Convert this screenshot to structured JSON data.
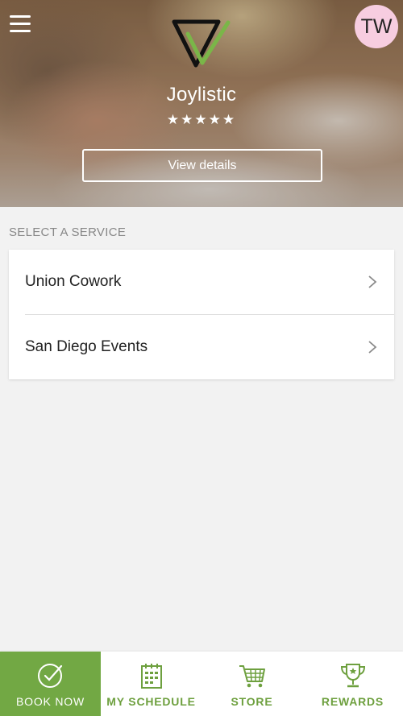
{
  "header": {
    "brand": "Joylistic",
    "rating_stars": "★★★★★",
    "rating": 5,
    "view_details": "View details",
    "avatar_initials": "TW",
    "avatar_color": "#f7cde0"
  },
  "section_title": "SELECT A SERVICE",
  "services": [
    {
      "label": "Union Cowork"
    },
    {
      "label": "San Diego Events"
    }
  ],
  "tabs": [
    {
      "label": "BOOK NOW",
      "icon": "check-circle-icon",
      "active": true
    },
    {
      "label": "MY SCHEDULE",
      "icon": "calendar-icon",
      "active": false
    },
    {
      "label": "STORE",
      "icon": "cart-icon",
      "active": false
    },
    {
      "label": "REWARDS",
      "icon": "trophy-icon",
      "active": false
    }
  ],
  "colors": {
    "accent": "#72a844",
    "background": "#f2f2f2",
    "text": "#222222",
    "muted": "#888888"
  }
}
